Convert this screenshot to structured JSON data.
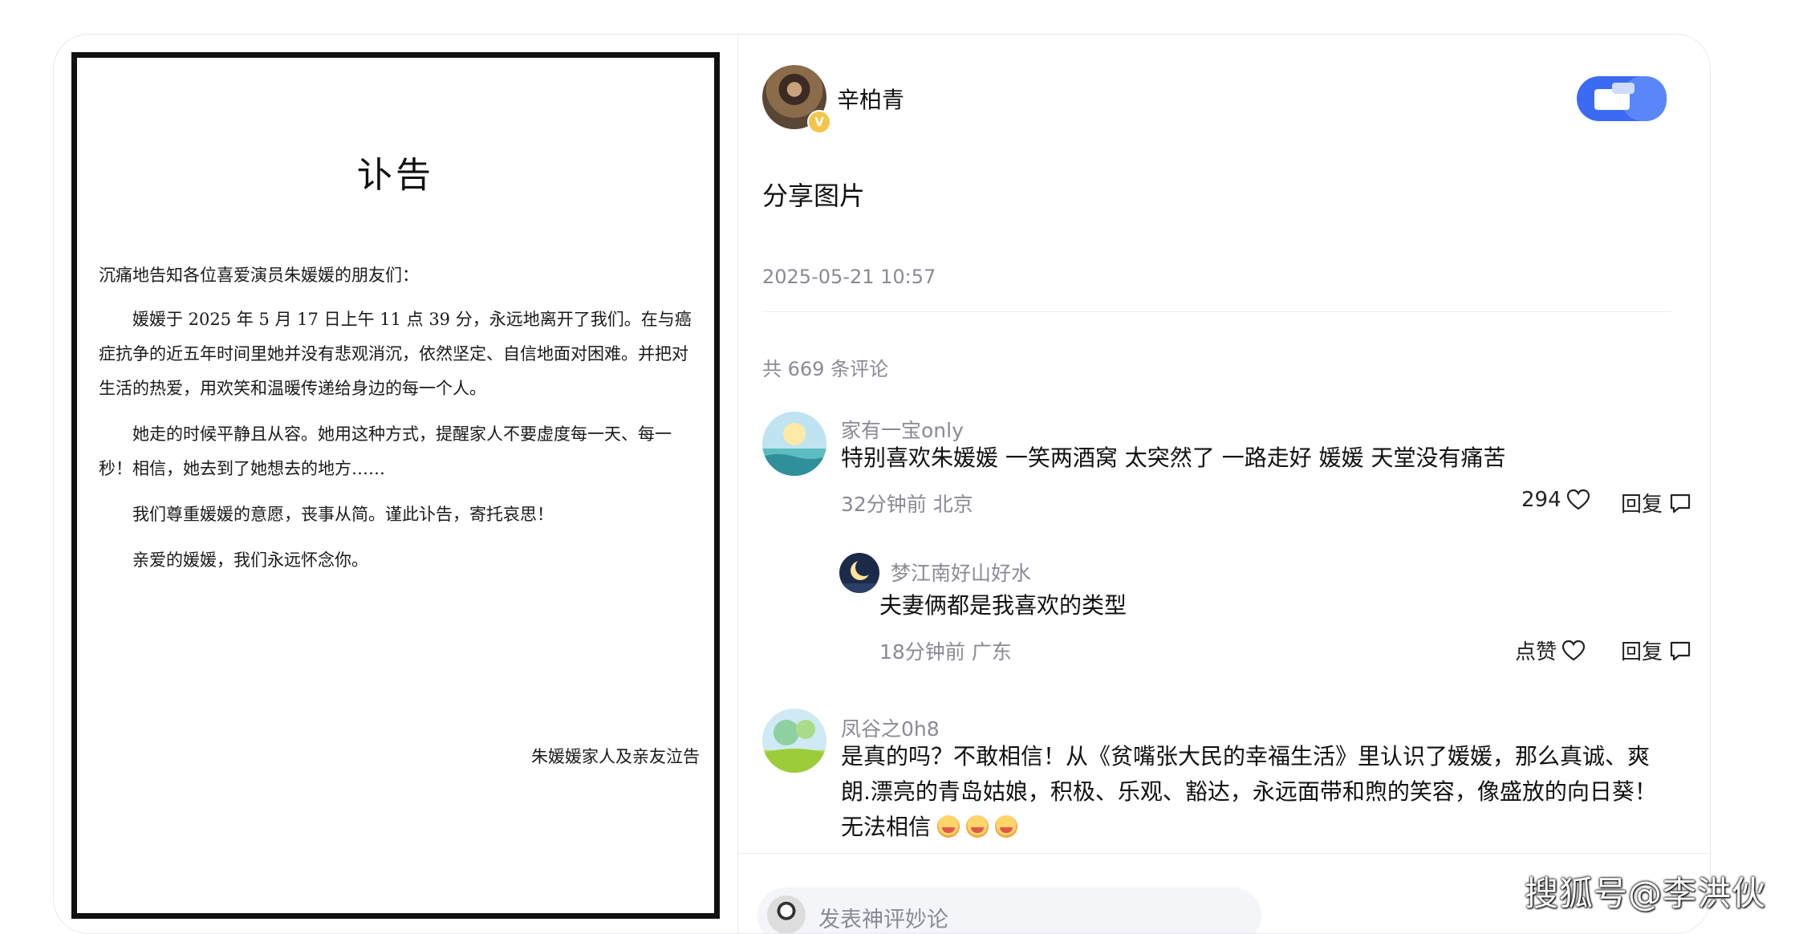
{
  "document": {
    "title": "讣告",
    "greeting": "沉痛地告知各位喜爱演员朱媛媛的朋友们：",
    "paragraphs": [
      "媛媛于 2025 年 5 月 17 日上午 11 点 39 分，永远地离开了我们。在与癌症抗争的近五年时间里她并没有悲观消沉，依然坚定、自信地面对困难。并把对生活的热爱，用欢笑和温暖传递给身边的每一个人。",
      "她走的时候平静且从容。她用这种方式，提醒家人不要虚度每一天、每一秒！相信，她去到了她想去的地方……",
      "我们尊重媛媛的意愿，丧事从简。谨此讣告，寄托哀思！",
      "亲爱的媛媛，我们永远怀念你。"
    ],
    "signature": "朱媛媛家人及亲友泣告"
  },
  "post": {
    "author": "辛柏青",
    "verified_mark": "V",
    "text": "分享图片",
    "time": "2025-05-21 10:57",
    "comment_count": "共 669 条评论"
  },
  "comments": [
    {
      "name": "家有一宝only",
      "text": "特别喜欢朱媛媛 一笑两酒窝 太突然了 一路走好 媛媛 天堂没有痛苦",
      "meta": "32分钟前  北京",
      "likes": "294",
      "reply_label": "回复"
    },
    {
      "name": "梦江南好山好水",
      "text": "夫妻俩都是我喜欢的类型",
      "meta": "18分钟前  广东",
      "likes": "点赞",
      "reply_label": "回复"
    },
    {
      "name": "凤谷之0h8",
      "text_lines": [
        "是真的吗？不敢相信！从《贫嘴张大民的幸福生活》里认识了媛媛，那么真诚、爽",
        "朗.漂亮的青岛姑娘，积极、乐观、豁达，永远面带和煦的笑容，像盛放的向日葵！",
        "无法相信"
      ]
    }
  ],
  "input": {
    "placeholder": "发表神评妙论"
  },
  "watermark": "搜狐号@李洪伙",
  "colors": {
    "brand_blue": "#3b6bf2",
    "muted": "#8a8a95"
  }
}
